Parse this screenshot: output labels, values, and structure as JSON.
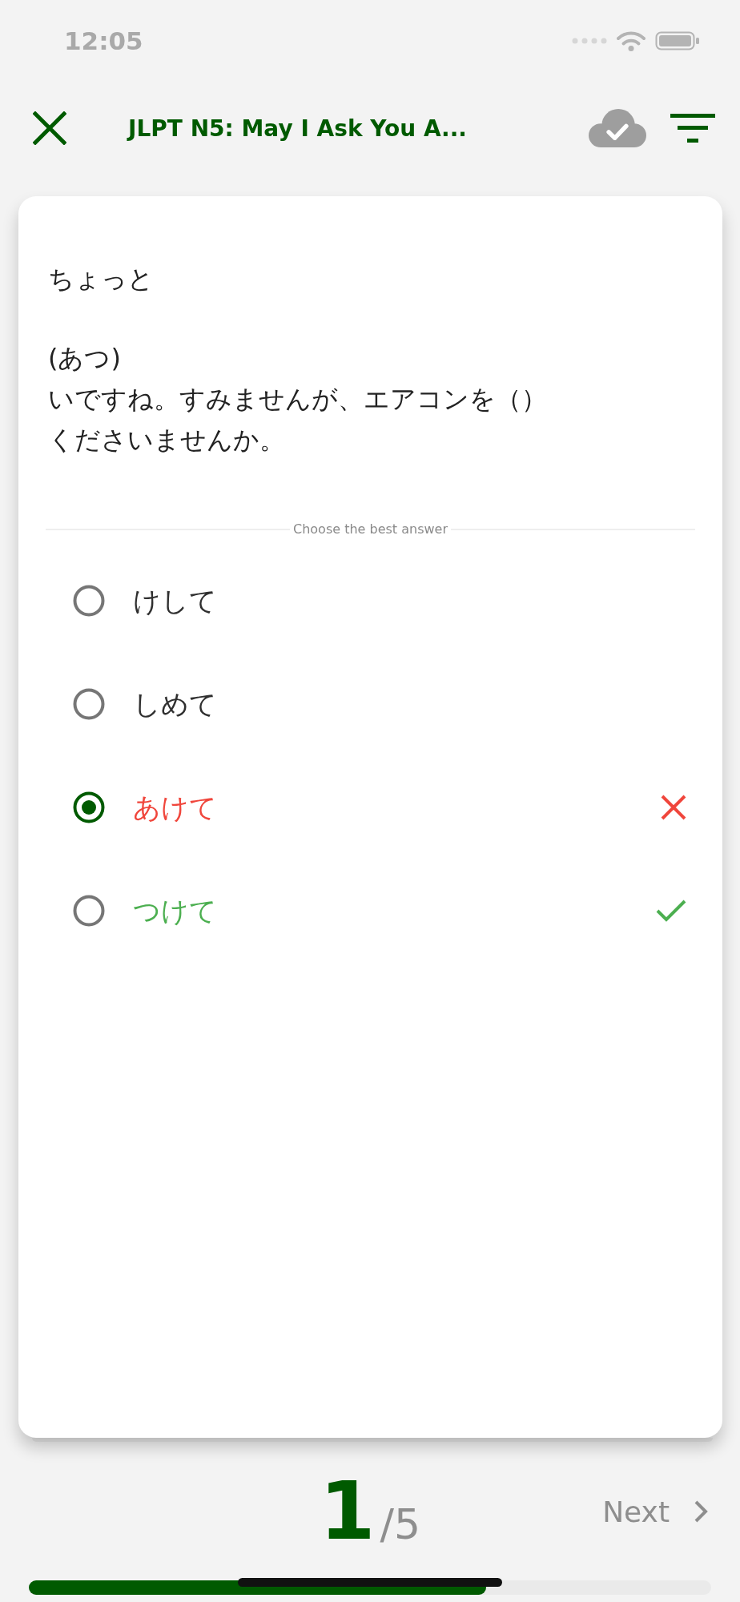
{
  "status_bar": {
    "time": "12:05"
  },
  "nav_bar": {
    "title": "JLPT N5: May I Ask You A..."
  },
  "question": {
    "prompt": "ちょっと",
    "sentence_lines": [
      "(あつ)",
      "いですね。すみませんが、エアコンを（）",
      "くださいませんか。"
    ]
  },
  "instruction": "Choose the best answer",
  "options": [
    {
      "text": "けして",
      "selected": false,
      "kind": "plain"
    },
    {
      "text": "しめて",
      "selected": false,
      "kind": "plain"
    },
    {
      "text": "あけて",
      "selected": true,
      "kind": "wrong"
    },
    {
      "text": "つけて",
      "selected": false,
      "kind": "correct"
    }
  ],
  "counter": {
    "current": "1",
    "total": "/5"
  },
  "next_button": {
    "label": "Next"
  },
  "progress": {
    "level": 0.67
  }
}
